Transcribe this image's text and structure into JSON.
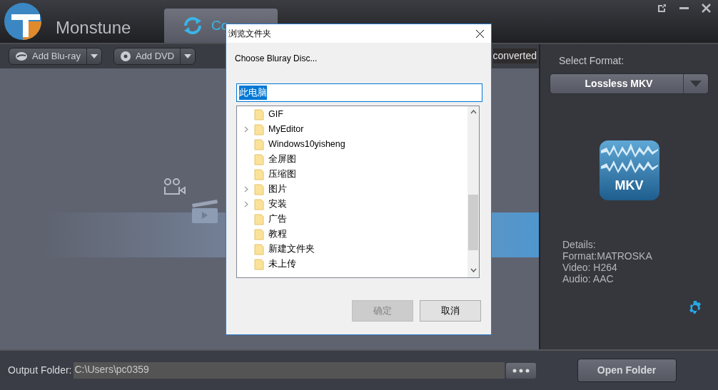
{
  "app": {
    "logo_text": "Monstune"
  },
  "tabs": [
    {
      "label": "Co",
      "selected": true
    }
  ],
  "toolbar": {
    "buttons": [
      {
        "label": "Add Blu-ray",
        "kind": "bluray"
      },
      {
        "label": "Add DVD",
        "kind": "dvd"
      }
    ],
    "status_text": "converted"
  },
  "format_panel": {
    "label": "Select Format:",
    "format": "Lossless MKV",
    "badge": "MKV",
    "details": [
      "Details:",
      "Format:MATROSKA",
      "Video: H264",
      "Audio: AAC"
    ]
  },
  "output": {
    "label": "Output Folder:",
    "path": "C:\\Users\\pc0359",
    "open_folder": "Open Folder"
  },
  "dialog": {
    "title": "浏览文件夹",
    "prompt": "Choose Bluray Disc...",
    "path_value": "此电脑",
    "folders": [
      {
        "name": "GIF",
        "expandable": false
      },
      {
        "name": "MyEditor",
        "expandable": true
      },
      {
        "name": "Windows10yisheng",
        "expandable": false
      },
      {
        "name": "全屏图",
        "expandable": false
      },
      {
        "name": "压缩图",
        "expandable": false
      },
      {
        "name": "图片",
        "expandable": true
      },
      {
        "name": "安装",
        "expandable": true
      },
      {
        "name": "广告",
        "expandable": false
      },
      {
        "name": "教程",
        "expandable": false
      },
      {
        "name": "新建文件夹",
        "expandable": false
      },
      {
        "name": "未上传",
        "expandable": false
      }
    ],
    "buttons": [
      {
        "label": "确定",
        "disabled": true
      },
      {
        "label": "取消",
        "disabled": false
      }
    ]
  }
}
